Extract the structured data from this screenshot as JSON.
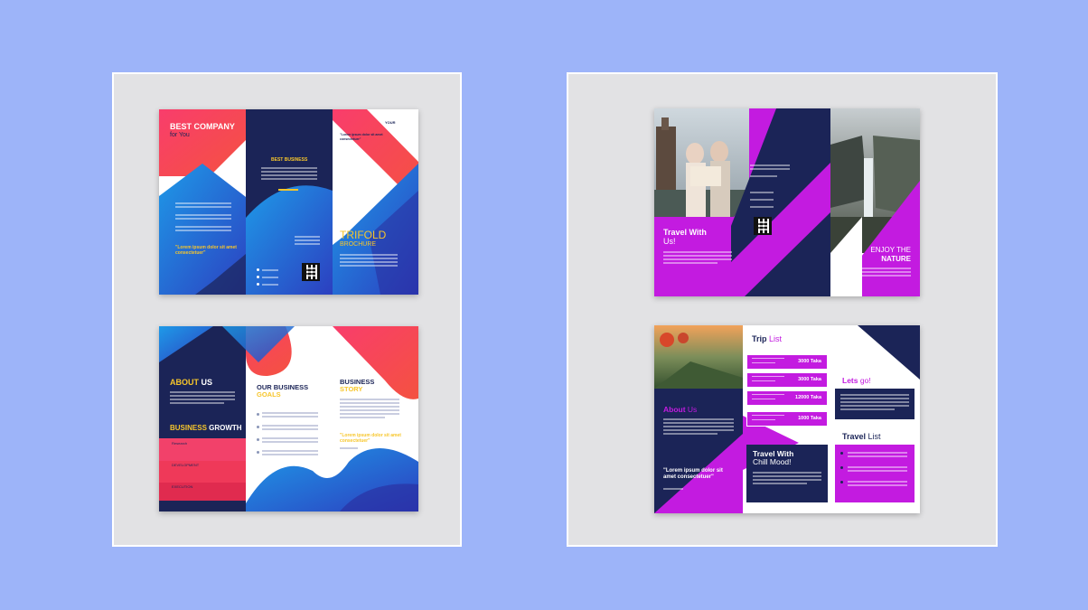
{
  "colors": {
    "background": "#9db4f9",
    "frame": "#e2e2e4",
    "navy": "#1b2457",
    "coral": "#f2416a",
    "blue": "#1e8ee6",
    "magenta": "#c31be0",
    "yellow": "#f7c62b"
  },
  "brochure_left_front": {
    "headline_1": "BEST COMPANY",
    "headline_2": "for You",
    "center_title": "BEST BUSINESS",
    "quote": "\"Lorem ipsum dolor sit amet consectetuer\"",
    "right_quote": "\"Lorem ipsum dolor sit amet consectetuer\"",
    "logo": "YOUR",
    "trifold_1": "TRIFOLD",
    "trifold_2": "BROCHURE",
    "qr_icon": "qr-code-icon"
  },
  "brochure_left_back": {
    "about_1": "ABOUT",
    "about_2": "US",
    "goals_1": "OUR BUSINESS",
    "goals_2": "GOALS",
    "story_1": "BUSINESS",
    "story_2": "STORY",
    "growth_1": "BUSINESS",
    "growth_2": "GROWTH",
    "growth_items": [
      "Research",
      "DEVELOPMENT",
      "EXECUTION"
    ],
    "story_quote": "\"Lorem ipsum dolor sit amet consectetuer\""
  },
  "brochure_right_front": {
    "travel_1": "Travel With",
    "travel_2": "Us!",
    "enjoy_1": "ENJOY THE",
    "enjoy_2": "NATURE",
    "qr_icon": "qr-code-icon"
  },
  "brochure_right_back": {
    "trip_1": "Trip",
    "trip_2": "List",
    "prices": [
      "3000 Taka",
      "3000 Taka",
      "12000 Taka",
      "1000 Taka"
    ],
    "lets_1": "Lets",
    "lets_2": "go!",
    "about_1": "About",
    "about_2": "Us",
    "chill_1": "Travel With",
    "chill_2": "Chill Mood!",
    "travel_list_1": "Travel",
    "travel_list_2": "List",
    "quote": "\"Lorem ipsum dolor sit amet consectetuer\""
  }
}
